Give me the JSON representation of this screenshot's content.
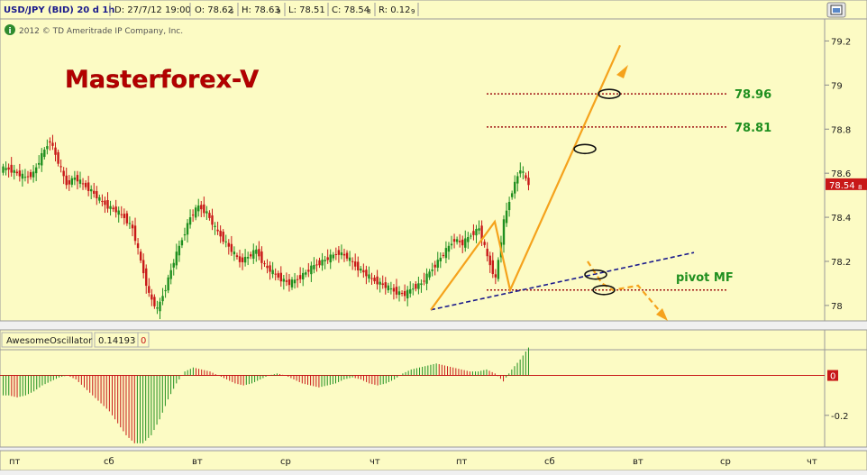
{
  "header": {
    "symbol": "USD/JPY (BID) 20 d 1h",
    "date": "D: 27/7/12 19:00",
    "open": "O: 78.62",
    "open_sub": "5",
    "high": "H: 78.63",
    "high_sub": "9",
    "low": "L: 78.51",
    "close": "C: 78.54",
    "close_sub": "8",
    "range": "R: 0.12",
    "range_sub": "9",
    "copyright": "2012 © TD Ameritrade IP Company, Inc.",
    "info_icon": "info-icon",
    "maximize_icon": "maximize-icon"
  },
  "watermark": "Masterforex-V",
  "levels": [
    {
      "price": 78.96,
      "label": "78.96"
    },
    {
      "price": 78.81,
      "label": "78.81"
    },
    {
      "price": 78.07,
      "label": "pivot MF"
    }
  ],
  "price_tag": {
    "value": "78.54",
    "sub": "8"
  },
  "oscillator": {
    "name": "AwesomeOscillator",
    "value": "0.14193",
    "zero_tag": "0"
  },
  "colors": {
    "panel_bg": "#fcfbc4",
    "bull": "#1f8f1f",
    "bear": "#c81818",
    "arrow": "#f5a21c",
    "trendline": "#1a1a8c",
    "level": "#a01414",
    "label_green": "#1f8f1f",
    "watermark": "#b30000"
  },
  "chart_data": [
    {
      "type": "candlestick",
      "series": "USD/JPY (BID) 20 d 1h",
      "y_ticks": [
        "79.2",
        "79",
        "78.8",
        "78.6",
        "78.4",
        "78.2",
        "78"
      ],
      "ylim": [
        77.93,
        79.3
      ],
      "x_ticks": [
        "пт",
        "сб",
        "вт",
        "ср",
        "чт",
        "пт",
        "сб",
        "вт",
        "ср",
        "чт"
      ],
      "last_close": 78.548,
      "approx_closes": [
        78.62,
        78.6,
        78.58,
        78.6,
        78.68,
        78.75,
        78.65,
        78.55,
        78.58,
        78.55,
        78.52,
        78.48,
        78.45,
        78.43,
        78.4,
        78.35,
        78.2,
        78.05,
        77.98,
        78.08,
        78.2,
        78.3,
        78.4,
        78.45,
        78.42,
        78.35,
        78.3,
        78.25,
        78.2,
        78.22,
        78.25,
        78.18,
        78.15,
        78.12,
        78.1,
        78.12,
        78.15,
        78.18,
        78.2,
        78.22,
        78.24,
        78.22,
        78.18,
        78.15,
        78.12,
        78.1,
        78.08,
        78.06,
        78.05,
        78.08,
        78.1,
        78.15,
        78.2,
        78.25,
        78.3,
        78.28,
        78.32,
        78.35,
        78.22,
        78.12,
        78.38,
        78.52,
        78.62,
        78.55
      ]
    },
    {
      "type": "bar",
      "series": "AwesomeOscillator",
      "y_ticks": [
        "0",
        "-0.2"
      ],
      "ylim": [
        -0.35,
        0.12
      ],
      "last_value": 0.14193,
      "approx_values": [
        -0.1,
        -0.11,
        -0.1,
        -0.08,
        -0.05,
        -0.03,
        -0.01,
        0.0,
        -0.02,
        -0.06,
        -0.1,
        -0.14,
        -0.18,
        -0.24,
        -0.3,
        -0.34,
        -0.34,
        -0.3,
        -0.22,
        -0.12,
        -0.04,
        0.02,
        0.04,
        0.03,
        0.02,
        0.0,
        -0.02,
        -0.04,
        -0.05,
        -0.04,
        -0.02,
        0.0,
        0.01,
        0.0,
        -0.02,
        -0.04,
        -0.05,
        -0.06,
        -0.05,
        -0.04,
        -0.02,
        -0.01,
        -0.02,
        -0.04,
        -0.05,
        -0.04,
        -0.02,
        0.01,
        0.03,
        0.04,
        0.05,
        0.06,
        0.05,
        0.04,
        0.03,
        0.02,
        0.02,
        0.03,
        0.01,
        -0.03,
        0.03,
        0.08,
        0.14
      ]
    }
  ]
}
